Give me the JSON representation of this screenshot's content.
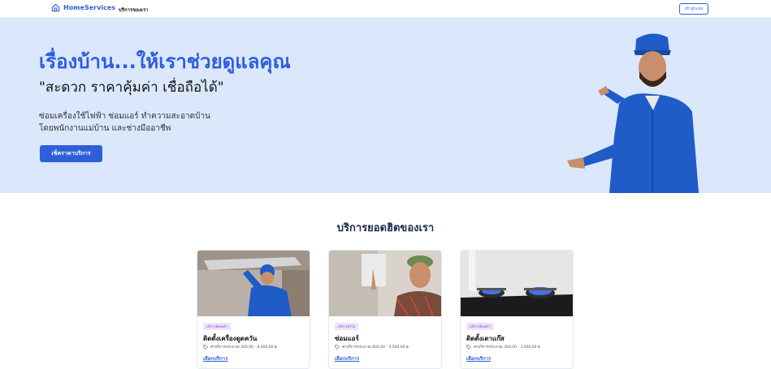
{
  "nav": {
    "brand": "HomeServices",
    "link_services": "บริการของเรา",
    "login_label": "เข้าสู่ระบบ"
  },
  "hero": {
    "headline": "เรื่องบ้าน...ให้เราช่วยดูแลคุณ",
    "tagline": "\"สะดวก ราคาคุ้มค่า เชื่อถือได้\"",
    "desc_line1": "ซ่อมเครื่องใช้ไฟฟ้า ซ่อมแอร์ ทำความสะอาดบ้าน",
    "desc_line2": "โดยพนักงานแม่บ้าน และช่างมืออาชีพ",
    "cta_label": "เช็คราคาบริการ"
  },
  "services": {
    "title": "บริการยอดฮิตของเรา",
    "items": [
      {
        "badge": "บริการห้องครัว",
        "name": "ติดตั้งเครื่องดูดควัน",
        "price": "ค่าบริการประมาณ 400.00 - 8,000.00 ฿",
        "link": "เลือกบริการ"
      },
      {
        "badge": "บริการทั่วไป",
        "name": "ซ่อมแอร์",
        "price": "ค่าบริการประมาณ 800.00 - 4,500.00 ฿",
        "link": "เลือกบริการ"
      },
      {
        "badge": "บริการห้องครัว",
        "name": "ติดตั้งเตาแก๊ส",
        "price": "ค่าบริการประมาณ 300.00 - 3,000.00 ฿",
        "link": "เลือกบริการ"
      }
    ]
  },
  "colors": {
    "accent": "#2f5fd8",
    "hero_bg": "#dbe8fc",
    "badge_bg": "#ede3fb"
  }
}
